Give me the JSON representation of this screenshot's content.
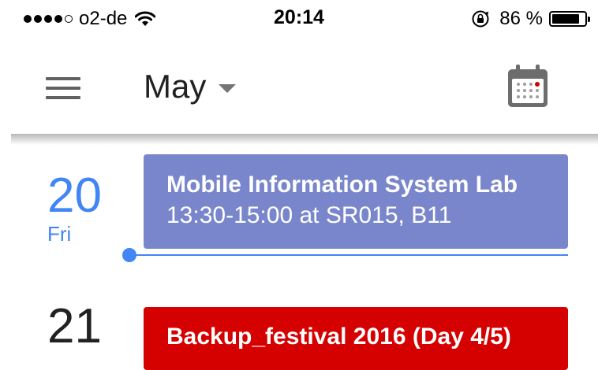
{
  "status_bar": {
    "carrier": "o2-de",
    "signal_filled": 4,
    "signal_total": 5,
    "time": "20:14",
    "battery_percent": "86 %",
    "battery_level": 0.86
  },
  "header": {
    "month": "May",
    "menu_icon": "hamburger-menu-icon",
    "calendar_icon": "calendar-today-icon"
  },
  "agenda": {
    "days": [
      {
        "day_number": "20",
        "day_name": "Fri",
        "is_today": true,
        "events": [
          {
            "title": "Mobile Information System Lab",
            "subtitle": "13:30-15:00 at SR015, B11",
            "color": "#7986cb"
          }
        ]
      },
      {
        "day_number": "21",
        "day_name": "",
        "is_today": false,
        "events": [
          {
            "title": "Backup_festival 2016 (Day 4/5)",
            "color": "#d50000"
          }
        ]
      }
    ]
  },
  "colors": {
    "accent": "#4285f4",
    "event_lavender": "#7986cb",
    "event_red": "#d50000"
  }
}
